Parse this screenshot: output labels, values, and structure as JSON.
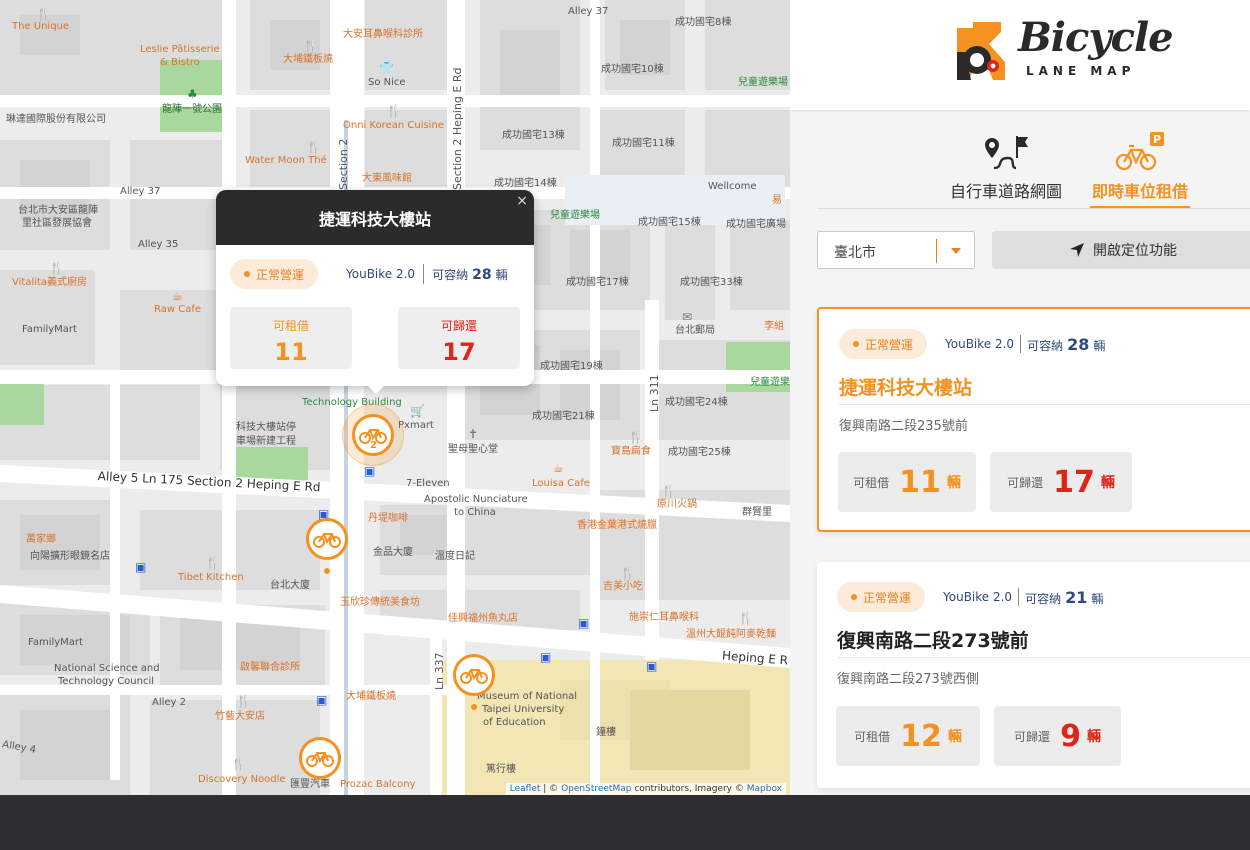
{
  "app": {
    "logo_title": "Bicycle",
    "logo_subtitle": "LANE MAP",
    "colors": {
      "accent": "#f5911e",
      "return_red": "#e02418",
      "brand_blue": "#2e4a7a"
    }
  },
  "tabs": [
    {
      "label": "自行車道路網圖",
      "icon": "route-map-icon",
      "active": false
    },
    {
      "label": "即時車位租借",
      "icon": "bike-parking-icon",
      "active": true
    }
  ],
  "filters": {
    "city": "臺北市",
    "locate_label": "開啟定位功能"
  },
  "cards": [
    {
      "status": "正常營運",
      "brand": "YouBike 2.0",
      "capacity_label": "可容納",
      "capacity": "28",
      "capacity_unit": "輛",
      "name": "捷運科技大樓站",
      "address": "復興南路二段235號前",
      "rent_label": "可租借",
      "rent": "11",
      "return_label": "可歸還",
      "return": "17",
      "unit": "輛",
      "selected": true
    },
    {
      "status": "正常營運",
      "brand": "YouBike 2.0",
      "capacity_label": "可容納",
      "capacity": "21",
      "capacity_unit": "輛",
      "name": "復興南路二段273號前",
      "address": "復興南路二段273號西側",
      "rent_label": "可租借",
      "rent": "12",
      "return_label": "可歸還",
      "return": "9",
      "unit": "輛",
      "selected": false
    }
  ],
  "popup": {
    "title": "捷運科技大樓站",
    "close": "×",
    "status": "正常營運",
    "brand": "YouBike 2.0",
    "capacity_label": "可容納",
    "capacity": "28",
    "capacity_unit": "輛",
    "rent_label": "可租借",
    "rent": "11",
    "return_label": "可歸還",
    "return": "17"
  },
  "map": {
    "labels": {
      "the_unique": "The Unique",
      "leslie1": "Leslie Pâtisserie",
      "leslie2": "& Bistro",
      "daan_clinic": "大安耳鼻喉科診所",
      "alley37a": "Alley 37",
      "c8": "成功國宅8棟",
      "dapu1": "大埔鐵板燒",
      "sonice": "So Nice",
      "c10": "成功國宅10棟",
      "playground1": "兒童遊樂場",
      "park1": "龍陣一號公園",
      "linda": "琳達國際股份有限公司",
      "onni": "Onni Korean Cuisine",
      "c13": "成功國宅13棟",
      "c11": "成功國宅11棟",
      "watermoon": "Water Moon Thé",
      "dadong": "大東風味館",
      "alley37b": "Alley 37",
      "c14": "成功國宅14棟",
      "wellcome": "Wellcome",
      "tp1": "台北市大安區龍陣",
      "tp2": "里社區發展協會",
      "playground2": "兒童遊樂場",
      "c15": "成功國宅15棟",
      "c_plaza": "成功國宅廣場",
      "alley35": "Alley 35",
      "vitalita": "Vitalita義式廚房",
      "c17": "成功國宅17棟",
      "c33": "成功國宅33棟",
      "rawcafe": "Raw Cafe",
      "familymart1": "FamilyMart",
      "post": "台北郵局",
      "c19": "成功國宅19棟",
      "playground3": "兒童遊樂",
      "techbuilding": "Technology Building",
      "pxmart": "Pxmart",
      "c21": "成功國宅21棟",
      "c24": "成功國宅24棟",
      "techpark1": "科技大樓站停",
      "techpark2": "車場新建工程",
      "holyheart": "聖母聖心堂",
      "baodao": "寶島扁食",
      "c25": "成功國宅25棟",
      "alley5": "Alley 5 Ln 175 Section 2 Heping E Rd",
      "seven": "7-Eleven",
      "louisa": "Louisa Cafe",
      "apostolic1": "Apostolic Nunciature",
      "apostolic2": "to China",
      "yuanchuan": "原川火鍋",
      "qunxian": "群賢里",
      "danqing": "丹堤咖啡",
      "hongkong": "香港金葉港式燒臘",
      "wanjiaxiang": "萬家鄉",
      "eyeglass": "向陽擴形眼鏡名店",
      "jinpin": "金品大廈",
      "wenshi": "溫度日記",
      "tibet": "Tibet Kitchen",
      "taibei": "台北大廈",
      "jimei": "吉美小吃",
      "yuxin": "玉欣珍傳統美食坊",
      "jiaxing": "佳興福州魚丸店",
      "shichong": "施崇仁耳鼻喉科",
      "familymart2": "FamilyMart",
      "wenzhou": "溫州大餛飩阿麥乾麵",
      "heping": "Heping E R",
      "qixin": "啟馨聯合診所",
      "nsc1": "National Science and",
      "nsc2": "Technology Council",
      "ln337": "Ln 337",
      "moe1": "Museum of National",
      "moe2": "Taipei University",
      "moe3": "of Education",
      "alley2": "Alley 2",
      "dapu2": "大埔鐵板燒",
      "clocktower": "鐘樓",
      "zhuyi": "竹藝大安店",
      "alley4": "Alley 4",
      "discovery": "Discovery Noodle",
      "lianmei": "匯豐汽車",
      "prozac": "Prozac Balcony",
      "zhuangjinglou": "篤行樓",
      "sec2a": "Section 2",
      "sec2b": "Section 2 Heping E Rd",
      "ln311": "Ln 311",
      "yi": "易",
      "likai": "李組"
    },
    "marker_cluster_count": "2",
    "attribution": {
      "leaflet": "Leaflet",
      "osm_prefix": "| ©",
      "osm": "OpenStreetMap",
      "mid": "contributors, Imagery ©",
      "mapbox": "Mapbox"
    }
  }
}
